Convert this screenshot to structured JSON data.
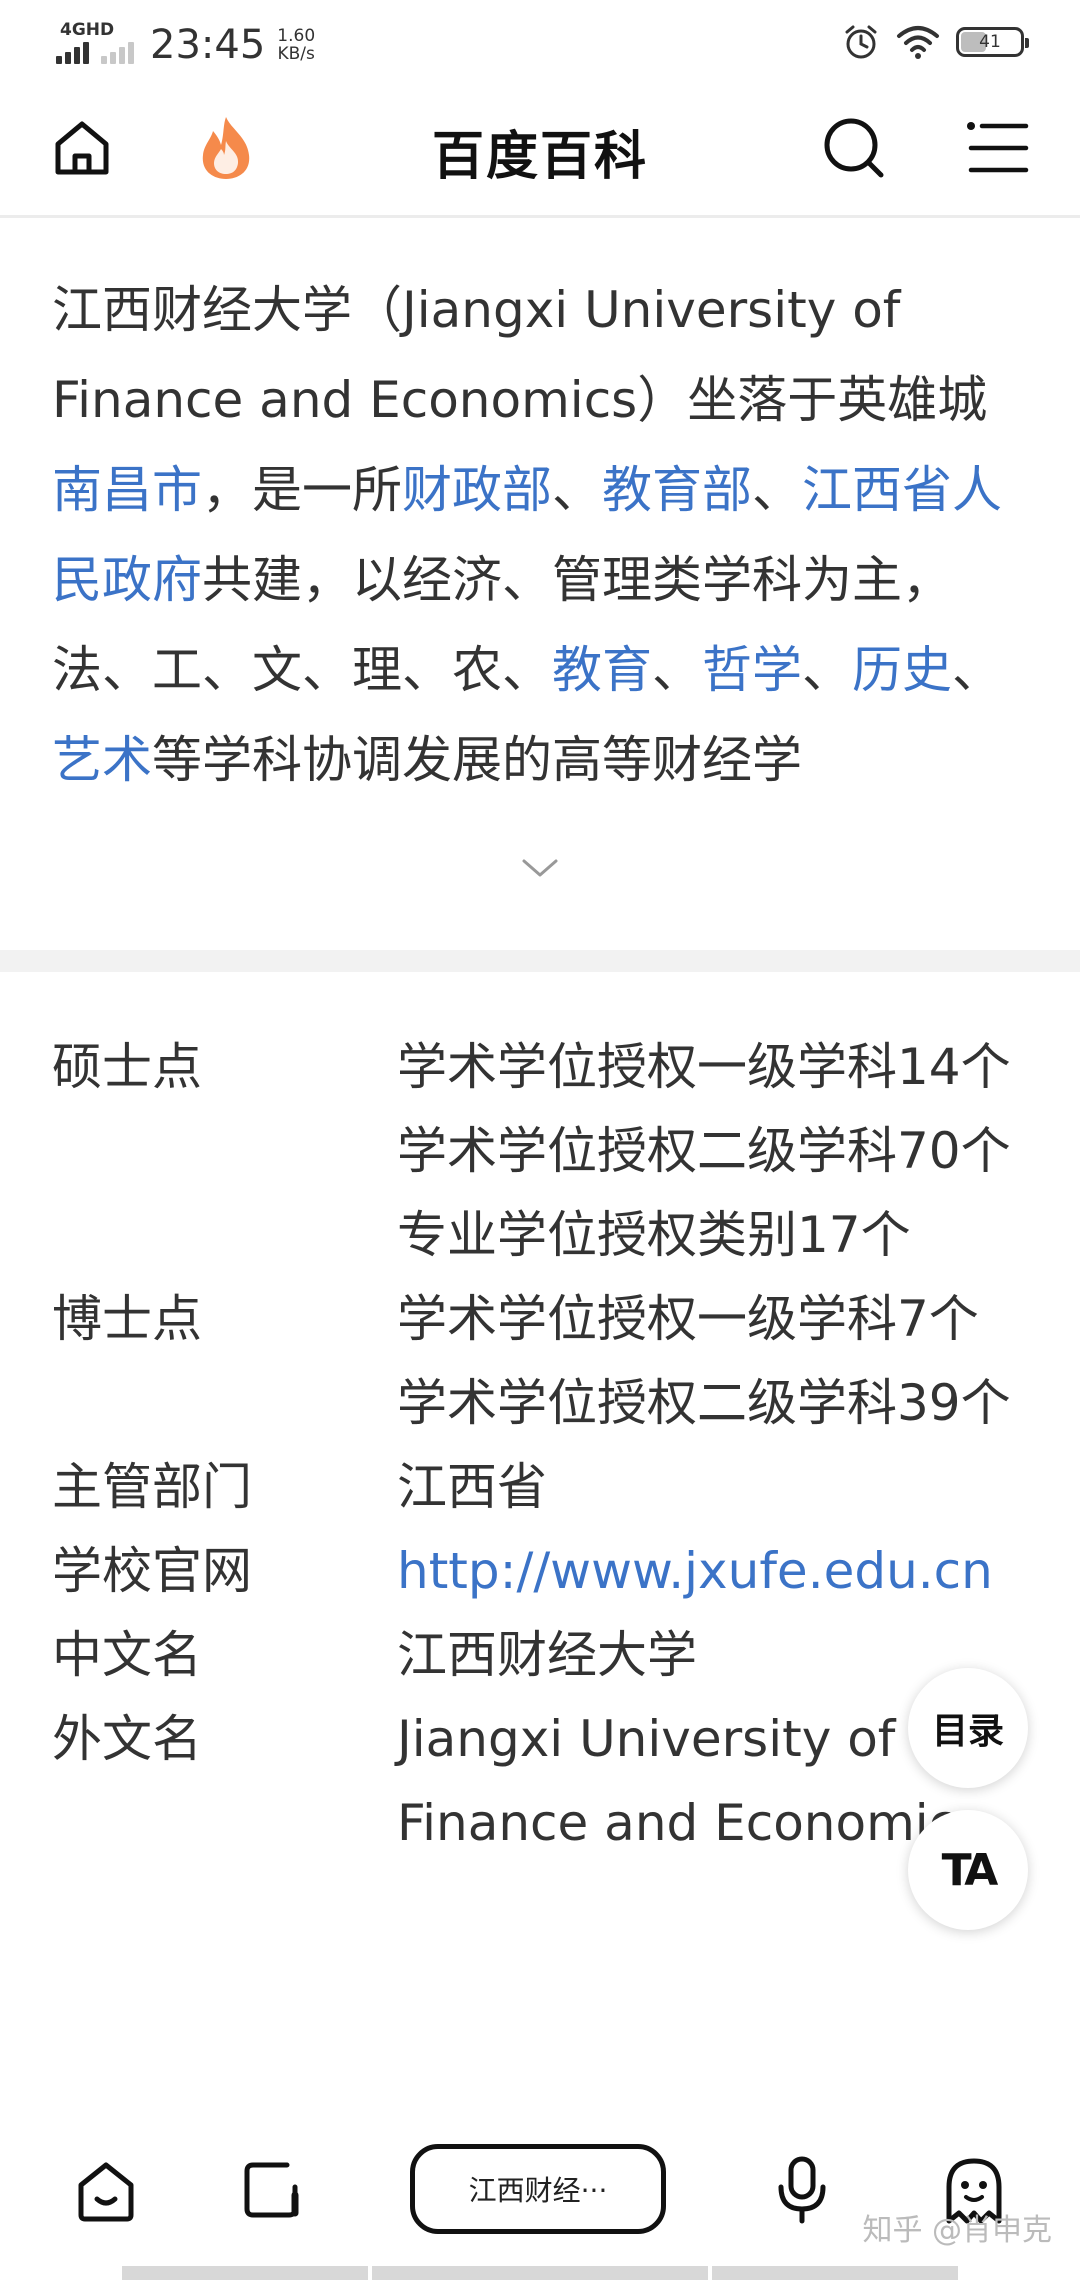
{
  "status_bar": {
    "network": "4GHD",
    "time": "23:45",
    "speed_value": "1.60",
    "speed_unit": "KB/s",
    "battery": "41"
  },
  "header": {
    "title": "百度百科",
    "icons": [
      "home-icon",
      "fire-icon",
      "search-icon",
      "menu-icon"
    ]
  },
  "intro": {
    "segments": [
      {
        "text": "江西财经大学（Jiangxi University of Finance and Economics）坐落于英雄城",
        "link": false
      },
      {
        "text": "南昌市",
        "link": true
      },
      {
        "text": "，是一所",
        "link": false
      },
      {
        "text": "财政部",
        "link": true
      },
      {
        "text": "、",
        "link": false
      },
      {
        "text": "教育部",
        "link": true
      },
      {
        "text": "、",
        "link": false
      },
      {
        "text": "江西省人民政府",
        "link": true
      },
      {
        "text": "共建，以经济、管理类学科为主，法、工、文、理、农、",
        "link": false
      },
      {
        "text": "教育",
        "link": true
      },
      {
        "text": "、",
        "link": false
      },
      {
        "text": "哲学",
        "link": true
      },
      {
        "text": "、",
        "link": false
      },
      {
        "text": "历史",
        "link": true
      },
      {
        "text": "、",
        "link": false
      },
      {
        "text": "艺术",
        "link": true
      },
      {
        "text": "等学科协调发展的高等财经学",
        "link": false
      }
    ]
  },
  "info": {
    "rows": [
      {
        "label": "硕士点",
        "lines": [
          "学术学位授权一级学科14个",
          "学术学位授权二级学科70个",
          "专业学位授权类别17个"
        ]
      },
      {
        "label": "博士点",
        "lines": [
          "学术学位授权一级学科7个",
          "学术学位授权二级学科39个"
        ]
      },
      {
        "label": "主管部门",
        "lines": [
          "江西省"
        ]
      },
      {
        "label": "学校官网",
        "lines": [
          "http://www.jxufe.edu.cn"
        ],
        "link": true
      },
      {
        "label": "中文名",
        "lines": [
          "江西财经大学"
        ]
      },
      {
        "label": "外文名",
        "lines": [
          "Jiangxi University of Finance and Economics"
        ]
      }
    ]
  },
  "fab": {
    "toc": "目录",
    "font": "TA"
  },
  "toolbar": {
    "search_text": "江西财经···"
  },
  "watermark": "知乎 @肖申克",
  "colors": {
    "link": "#3b73c7",
    "accent_fire": "#f58a4b",
    "text": "#333333"
  }
}
